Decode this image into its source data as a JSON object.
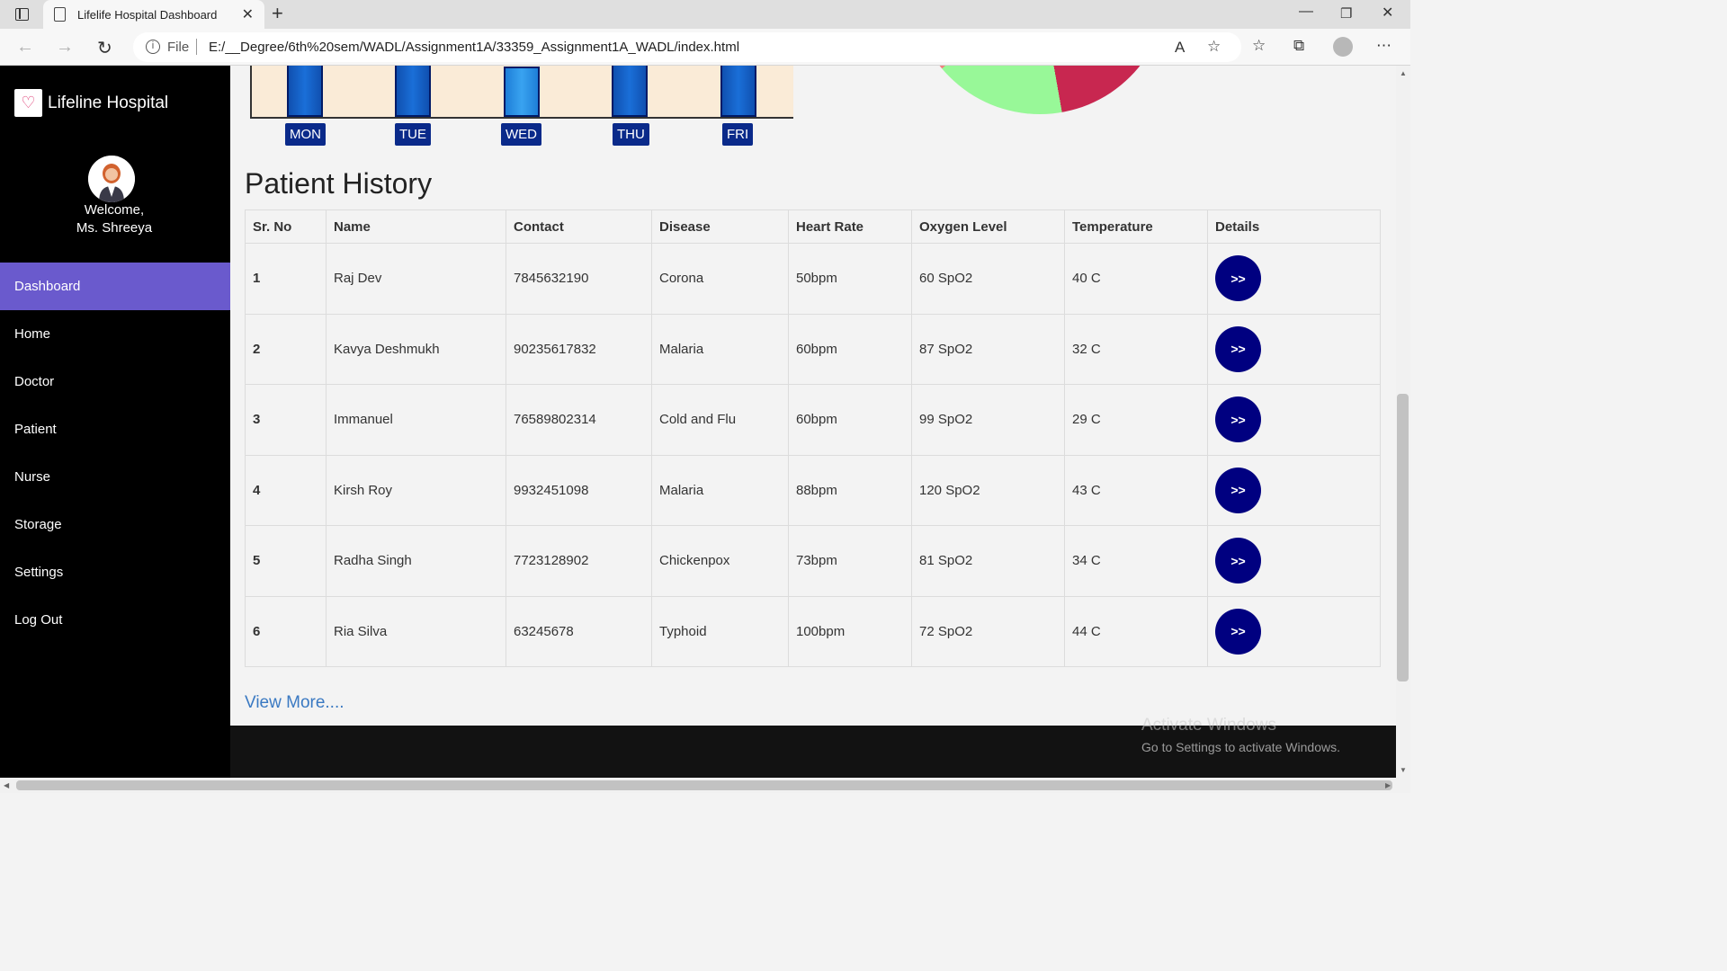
{
  "browser": {
    "tab_title": "Lifelife Hospital Dashboard",
    "file_label": "File",
    "url": "E:/__Degree/6th%20sem/WADL/Assignment1A/33359_Assignment1A_WADL/index.html"
  },
  "sidebar": {
    "brand": "Lifeline Hospital",
    "welcome_line1": "Welcome,",
    "welcome_line2": "Ms. Shreeya",
    "items": [
      {
        "label": "Dashboard",
        "active": true
      },
      {
        "label": "Home"
      },
      {
        "label": "Doctor"
      },
      {
        "label": "Patient"
      },
      {
        "label": "Nurse"
      },
      {
        "label": "Storage"
      },
      {
        "label": "Settings"
      },
      {
        "label": "Log Out"
      }
    ]
  },
  "chart_data": [
    {
      "type": "bar",
      "categories": [
        "MON",
        "TUE",
        "WED",
        "THU",
        "FRI"
      ],
      "colors": [
        "#1a6fd8",
        "#1a6fd8",
        "#39a3f0",
        "#1a6fd8",
        "#1a6fd8"
      ]
    },
    {
      "type": "pie",
      "colors": [
        "#c82750",
        "#98f898",
        "#f08080"
      ]
    }
  ],
  "patient_history": {
    "title": "Patient History",
    "columns": [
      "Sr. No",
      "Name",
      "Contact",
      "Disease",
      "Heart Rate",
      "Oxygen Level",
      "Temperature",
      "Details"
    ],
    "rows": [
      {
        "sr": "1",
        "name": "Raj Dev",
        "contact": "7845632190",
        "disease": "Corona",
        "heart_rate": "50bpm",
        "oxygen": "60 SpO2",
        "temperature": "40 C",
        "details": ">>"
      },
      {
        "sr": "2",
        "name": "Kavya Deshmukh",
        "contact": "90235617832",
        "disease": "Malaria",
        "heart_rate": "60bpm",
        "oxygen": "87 SpO2",
        "temperature": "32 C",
        "details": ">>"
      },
      {
        "sr": "3",
        "name": "Immanuel",
        "contact": "76589802314",
        "disease": "Cold and Flu",
        "heart_rate": "60bpm",
        "oxygen": "99 SpO2",
        "temperature": "29 C",
        "details": ">>"
      },
      {
        "sr": "4",
        "name": "Kirsh Roy",
        "contact": "9932451098",
        "disease": "Malaria",
        "heart_rate": "88bpm",
        "oxygen": "120 SpO2",
        "temperature": "43 C",
        "details": ">>"
      },
      {
        "sr": "5",
        "name": "Radha Singh",
        "contact": "7723128902",
        "disease": "Chickenpox",
        "heart_rate": "73bpm",
        "oxygen": "81 SpO2",
        "temperature": "34 C",
        "details": ">>"
      },
      {
        "sr": "6",
        "name": "Ria Silva",
        "contact": "63245678",
        "disease": "Typhoid",
        "heart_rate": "100bpm",
        "oxygen": "72 SpO2",
        "temperature": "44 C",
        "details": ">>"
      }
    ],
    "view_more": "View More...."
  },
  "watermark": {
    "line1": "Activate Windows",
    "line2": "Go to Settings to activate Windows."
  }
}
